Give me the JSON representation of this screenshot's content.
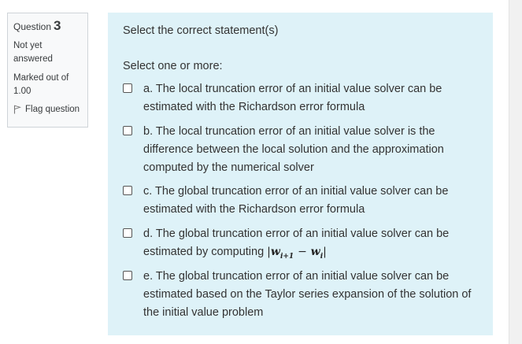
{
  "question_info": {
    "label": "Question",
    "number": "3",
    "state": "Not yet answered",
    "grade": "Marked out of 1.00",
    "flag_label": "Flag question"
  },
  "question": {
    "text": "Select the correct statement(s)",
    "prompt": "Select one or more:",
    "options": [
      {
        "label": "a. The local truncation error of an initial value solver can be estimated with the Richardson error formula",
        "checked": false
      },
      {
        "label": "b. The local truncation error of an initial value solver is the difference between the local solution and the approximation computed by the numerical solver",
        "checked": false
      },
      {
        "label": "c. The global truncation error of an initial value solver can be estimated with the Richardson error formula",
        "checked": false
      },
      {
        "label": "d. The global truncation error of an initial value solver can be estimated by computing",
        "math": "|w_{i+1} − w_i|",
        "checked": false
      },
      {
        "label": "e. The global truncation error of an initial value solver can be estimated based on the Taylor series expansion of the solution of the initial value problem",
        "checked": false
      }
    ]
  }
}
